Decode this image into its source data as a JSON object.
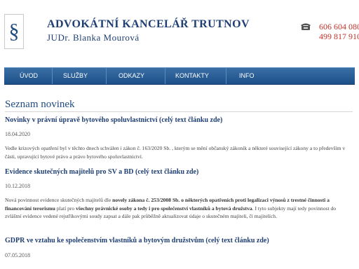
{
  "header": {
    "logo_glyph": "§",
    "title": "ADVOKÁTNÍ KANCELÁŘ TRUTNOV",
    "subtitle": "JUDr. Blanka Mourová",
    "phone_icon": "telephone-icon",
    "phones": [
      "606 604 080",
      "499 817 910"
    ]
  },
  "nav": {
    "items": [
      {
        "label": "Úvod"
      },
      {
        "label": "Služby"
      },
      {
        "label": "Odkazy"
      },
      {
        "label": "Kontakty"
      },
      {
        "label": "Info"
      }
    ]
  },
  "main": {
    "section_title": "Seznam novinek",
    "news": [
      {
        "title": "Novinky v právní úpravě bytového spoluvlastnictví (celý text článku zde)",
        "date": "18.04.2020",
        "text": "Vedle krizových opatření byl  v těchto dnech schválen i zákon č. 163/2020 Sb. , kterým se mění občanský zákoník a  některé související zákony a to především v části, upravující  bytové právo a právo bytového spoluvlastnictví."
      },
      {
        "title": "Evidence skutečných majitelů pro SV a BD (celý text článku zde)",
        "date": "10.12.2018",
        "text_parts": [
          {
            "t": "Nová povinnost evidence skutečných majitelů dle ",
            "b": false
          },
          {
            "t": "novely zákona č. 253/2008 Sb. o některých opatřeních proti legalizaci výnosů z trestné činnosti a financování terorismu",
            "b": true
          },
          {
            "t": "  platí pro ",
            "b": false
          },
          {
            "t": "všechny právnické osoby a tedy i pro společenství vlastníků  a bytová družstva",
            "b": true
          },
          {
            "t": ".  I tyto subjekty mají tedy povinnost  do zvláštní evidence vedené rejstříkovými soudy zapsat a dále pak průběžně aktualizovat údaje o skutečném majiteli, či majitelích.",
            "b": false
          }
        ]
      },
      {
        "title": "GDPR ve vztahu ke společenstvím vlastníků a bytovým družstvům (celý text článku zde)",
        "date": "07.05.2018"
      }
    ]
  }
}
